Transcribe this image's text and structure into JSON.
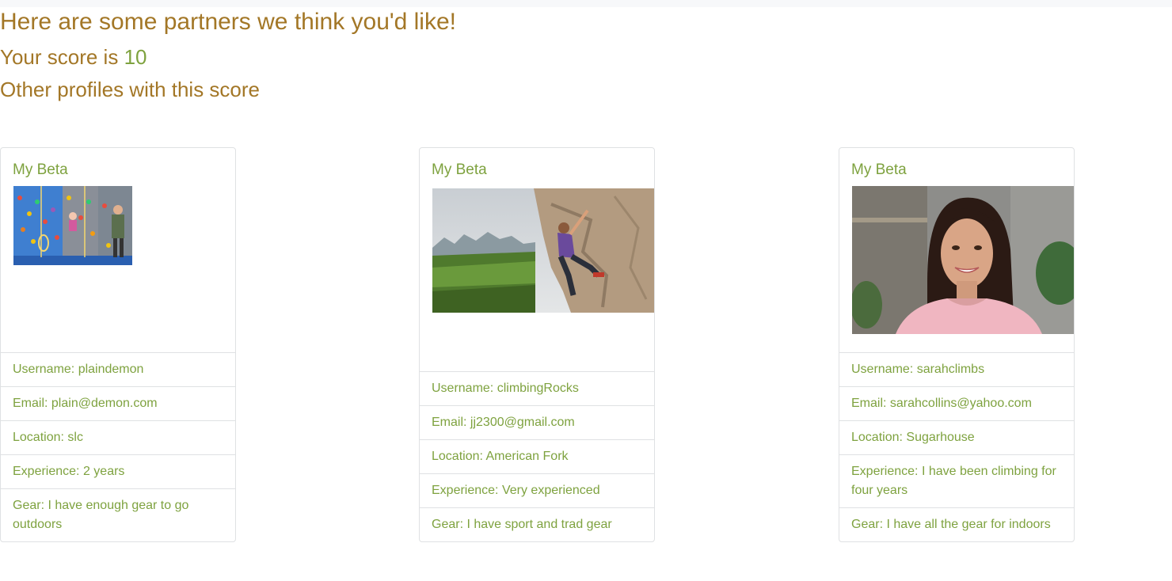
{
  "header": {
    "title": "Here are some partners we think you'd like!",
    "score_prefix": "Your score is",
    "score_value": "10",
    "other_profiles": "Other profiles with this score"
  },
  "labels": {
    "username": "Username:",
    "email": "Email:",
    "location": "Location:",
    "experience": "Experience:",
    "gear": "Gear:"
  },
  "cards": [
    {
      "title": "My Beta",
      "username": "plaindemon",
      "email": "plain@demon.com",
      "location": "slc",
      "experience": "2 years",
      "gear": "I have enough gear to go outdoors"
    },
    {
      "title": "My Beta",
      "username": "climbingRocks",
      "email": "jj2300@gmail.com",
      "location": "American Fork",
      "experience": "Very experienced",
      "gear": "I have sport and trad gear"
    },
    {
      "title": "My Beta",
      "username": "sarahclimbs",
      "email": "sarahcollins@yahoo.com",
      "location": "Sugarhouse",
      "experience": "I have been climbing for four years",
      "gear": "I have all the gear for indoors"
    }
  ]
}
